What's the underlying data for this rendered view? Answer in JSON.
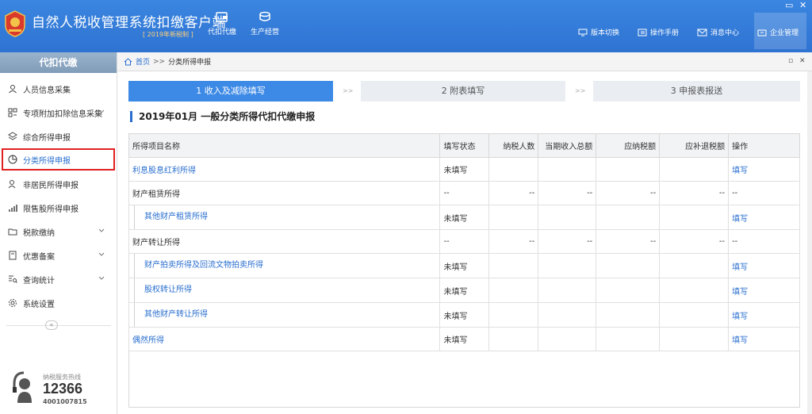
{
  "app": {
    "title": "自然人税收管理系统扣缴客户端",
    "subtitle": "[ 2019年新税制 ]"
  },
  "header": {
    "modules": [
      {
        "label": "代扣代缴",
        "icon": "wallet-icon"
      },
      {
        "label": "生产经营",
        "icon": "coins-icon"
      }
    ],
    "buttons": [
      {
        "label": "版本切换",
        "icon": "monitor-icon"
      },
      {
        "label": "操作手册",
        "icon": "book-icon"
      },
      {
        "label": "消息中心",
        "icon": "mail-icon"
      },
      {
        "label": "企业管理",
        "icon": "building-icon"
      }
    ],
    "window_controls": [
      "▭",
      "✕"
    ]
  },
  "sidebar": {
    "title": "代扣代缴",
    "items": [
      {
        "label": "人员信息采集",
        "icon": "user-icon",
        "expandable": false
      },
      {
        "label": "专项附加扣除信息采集",
        "icon": "grid-icon",
        "expandable": true
      },
      {
        "label": "综合所得申报",
        "icon": "layers-icon",
        "expandable": false
      },
      {
        "label": "分类所得申报",
        "icon": "pie-chart-icon",
        "expandable": false,
        "active": true
      },
      {
        "label": "非居民所得申报",
        "icon": "person-icon",
        "expandable": false
      },
      {
        "label": "限售股所得申报",
        "icon": "bar-chart-icon",
        "expandable": false
      },
      {
        "label": "税款缴纳",
        "icon": "folder-icon",
        "expandable": true
      },
      {
        "label": "优惠备案",
        "icon": "document-icon",
        "expandable": true
      },
      {
        "label": "查询统计",
        "icon": "search-list-icon",
        "expandable": true
      },
      {
        "label": "系统设置",
        "icon": "gear-icon",
        "expandable": false
      }
    ],
    "collapse_label": "«",
    "hotline": {
      "label": "纳税服务热线",
      "number": "12366",
      "phone": "4001007815"
    }
  },
  "breadcrumb": {
    "home": "首页",
    "separator": ">>",
    "current": "分类所得申报"
  },
  "steps": [
    {
      "label": "1 收入及减除填写",
      "state": "done"
    },
    {
      "label": "2 附表填写",
      "state": "todo"
    },
    {
      "label": "3 申报表报送",
      "state": "todo"
    }
  ],
  "step_separator": ">>",
  "section_title": "2019年01月  一般分类所得代扣代缴申报",
  "table": {
    "headers": [
      "所得项目名称",
      "填写状态",
      "纳税人数",
      "当期收入总额",
      "应纳税额",
      "应补退税额",
      "操作"
    ],
    "rows": [
      {
        "name": "利息股息红利所得",
        "level": 1,
        "link": true,
        "status": "未填写",
        "count": "",
        "income": "",
        "tax": "",
        "refund": "",
        "op": "填写"
      },
      {
        "name": "财产租赁所得",
        "level": 0,
        "link": false,
        "status": "--",
        "count": "--",
        "income": "--",
        "tax": "--",
        "refund": "--",
        "op": "--"
      },
      {
        "name": "其他财产租赁所得",
        "level": 2,
        "link": true,
        "status": "未填写",
        "count": "",
        "income": "",
        "tax": "",
        "refund": "",
        "op": "填写"
      },
      {
        "name": "财产转让所得",
        "level": 0,
        "link": false,
        "status": "--",
        "count": "--",
        "income": "--",
        "tax": "--",
        "refund": "--",
        "op": "--"
      },
      {
        "name": "财产拍卖所得及回流文物拍卖所得",
        "level": 2,
        "link": true,
        "status": "未填写",
        "count": "",
        "income": "",
        "tax": "",
        "refund": "",
        "op": "填写"
      },
      {
        "name": "股权转让所得",
        "level": 2,
        "link": true,
        "status": "未填写",
        "count": "",
        "income": "",
        "tax": "",
        "refund": "",
        "op": "填写"
      },
      {
        "name": "其他财产转让所得",
        "level": 2,
        "link": true,
        "status": "未填写",
        "count": "",
        "income": "",
        "tax": "",
        "refund": "",
        "op": "填写"
      },
      {
        "name": "偶然所得",
        "level": 1,
        "link": true,
        "status": "未填写",
        "count": "",
        "income": "",
        "tax": "",
        "refund": "",
        "op": "填写"
      }
    ]
  },
  "colors": {
    "header_blue": "#2f73d2",
    "link_blue": "#2a6fcf",
    "highlight_red": "#e02020",
    "step_active": "#3d8ae6"
  }
}
